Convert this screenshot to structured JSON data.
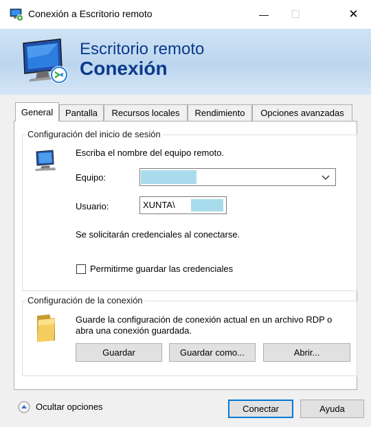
{
  "window": {
    "title": "Conexión a Escritorio remoto",
    "minimize_glyph": "—",
    "maximize_glyph": "☐",
    "close_glyph": "✕"
  },
  "banner": {
    "line1": "Escritorio remoto",
    "line2": "Conexión"
  },
  "tabs": [
    {
      "label": "General",
      "active": true
    },
    {
      "label": "Pantalla",
      "active": false
    },
    {
      "label": "Recursos locales",
      "active": false
    },
    {
      "label": "Rendimiento",
      "active": false
    },
    {
      "label": "Opciones avanzadas",
      "active": false
    }
  ],
  "login_group": {
    "title": "Configuración del inicio de sesión",
    "instruction": "Escriba el nombre del equipo remoto.",
    "computer_label": "Equipo:",
    "computer_value": "",
    "user_label": "Usuario:",
    "user_value": "XUNTA\\",
    "credentials_note": "Se solicitarán credenciales al conectarse.",
    "save_credentials_label": "Permitirme guardar las credenciales",
    "save_credentials_checked": false
  },
  "connection_group": {
    "title": "Configuración de la conexión",
    "description": "Guarde la configuración de conexión actual en un archivo RDP o abra una conexión guardada.",
    "save_label": "Guardar",
    "save_as_label": "Guardar como...",
    "open_label": "Abrir..."
  },
  "footer": {
    "hide_options_label": "Ocultar opciones",
    "connect_label": "Conectar",
    "help_label": "Ayuda"
  },
  "colors": {
    "accent": "#0078d7",
    "banner_text": "#0b3a8c",
    "redaction": "#a8dcec"
  },
  "icons": {
    "app": "remote-desktop-icon",
    "banner": "remote-desktop-icon",
    "computer": "computer-icon",
    "folder": "folder-icon",
    "collapse": "chevron-up-icon",
    "dropdown": "chevron-down-icon"
  }
}
